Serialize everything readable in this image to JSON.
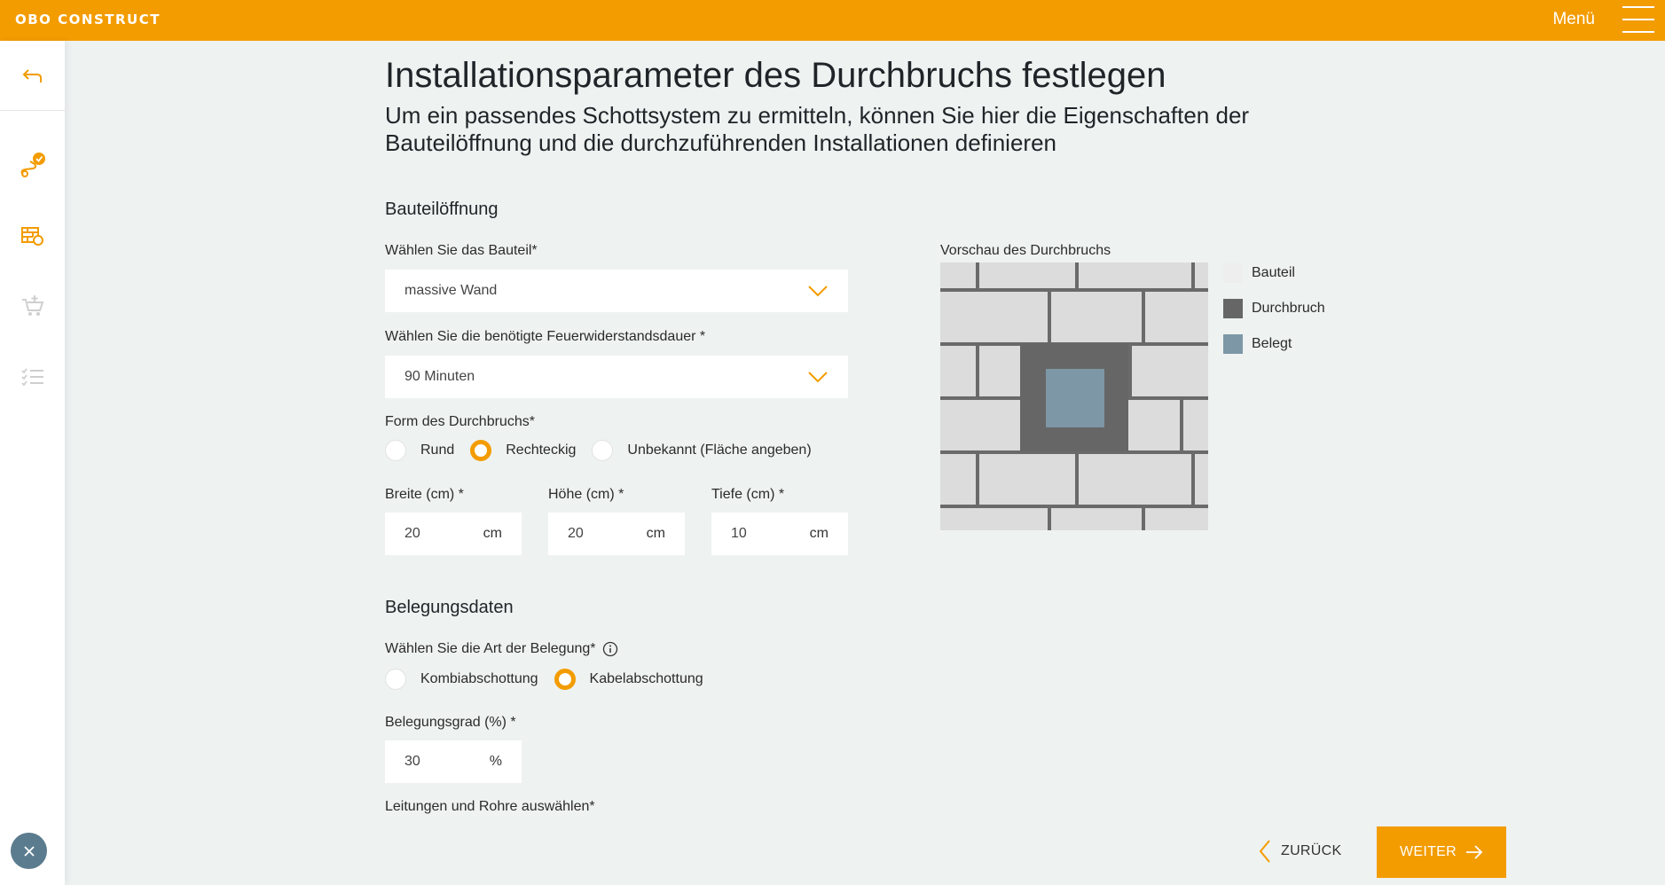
{
  "header": {
    "logo": "OBO CONSTRUCT",
    "menu_label": "Menü"
  },
  "sidebar": {
    "items": [
      {
        "icon": "back-arrow-icon"
      },
      {
        "icon": "route-check-icon"
      },
      {
        "icon": "wall-settings-icon"
      },
      {
        "icon": "cart-add-icon"
      },
      {
        "icon": "checklist-icon"
      }
    ],
    "close_icon": "close-icon"
  },
  "page": {
    "title": "Installationsparameter des Durchbruchs festlegen",
    "subtitle": "Um ein passendes Schottsystem zu ermitteln, können Sie hier die Eigenschaften der Bauteilöffnung und die durchzuführenden Installationen definieren"
  },
  "opening": {
    "section_title": "Bauteilöffnung",
    "component_label": "Wählen Sie das Bauteil*",
    "component_value": "massive Wand",
    "fire_label": "Wählen Sie die benötigte Feuerwiderstandsdauer *",
    "fire_value": "90 Minuten",
    "shape_label": "Form des Durchbruchs*",
    "shape_options": [
      "Rund",
      "Rechteckig",
      "Unbekannt (Fläche angeben)"
    ],
    "shape_selected": "Rechteckig",
    "width_label": "Breite (cm) *",
    "width_value": "20",
    "height_label": "Höhe (cm) *",
    "height_value": "20",
    "depth_label": "Tiefe (cm) *",
    "depth_value": "10",
    "unit_cm": "cm"
  },
  "preview": {
    "label": "Vorschau des Durchbruchs",
    "legend": [
      {
        "label": "Bauteil",
        "color": "#eeeeee"
      },
      {
        "label": "Durchbruch",
        "color": "#666666"
      },
      {
        "label": "Belegt",
        "color": "#7d97a6"
      }
    ]
  },
  "occupancy": {
    "section_title": "Belegungsdaten",
    "type_label": "Wählen Sie die Art der Belegung*",
    "type_options": [
      "Kombiabschottung",
      "Kabelabschottung"
    ],
    "type_selected": "Kabelabschottung",
    "degree_label": "Belegungsgrad (%) *",
    "degree_value": "30",
    "degree_unit": "%",
    "lines_label": "Leitungen und Rohre auswählen*"
  },
  "footer": {
    "back_label": "ZURÜCK",
    "next_label": "WEITER"
  },
  "colors": {
    "accent": "#f39c00",
    "background": "#eef2f1",
    "close_button": "#5b7c8e"
  }
}
